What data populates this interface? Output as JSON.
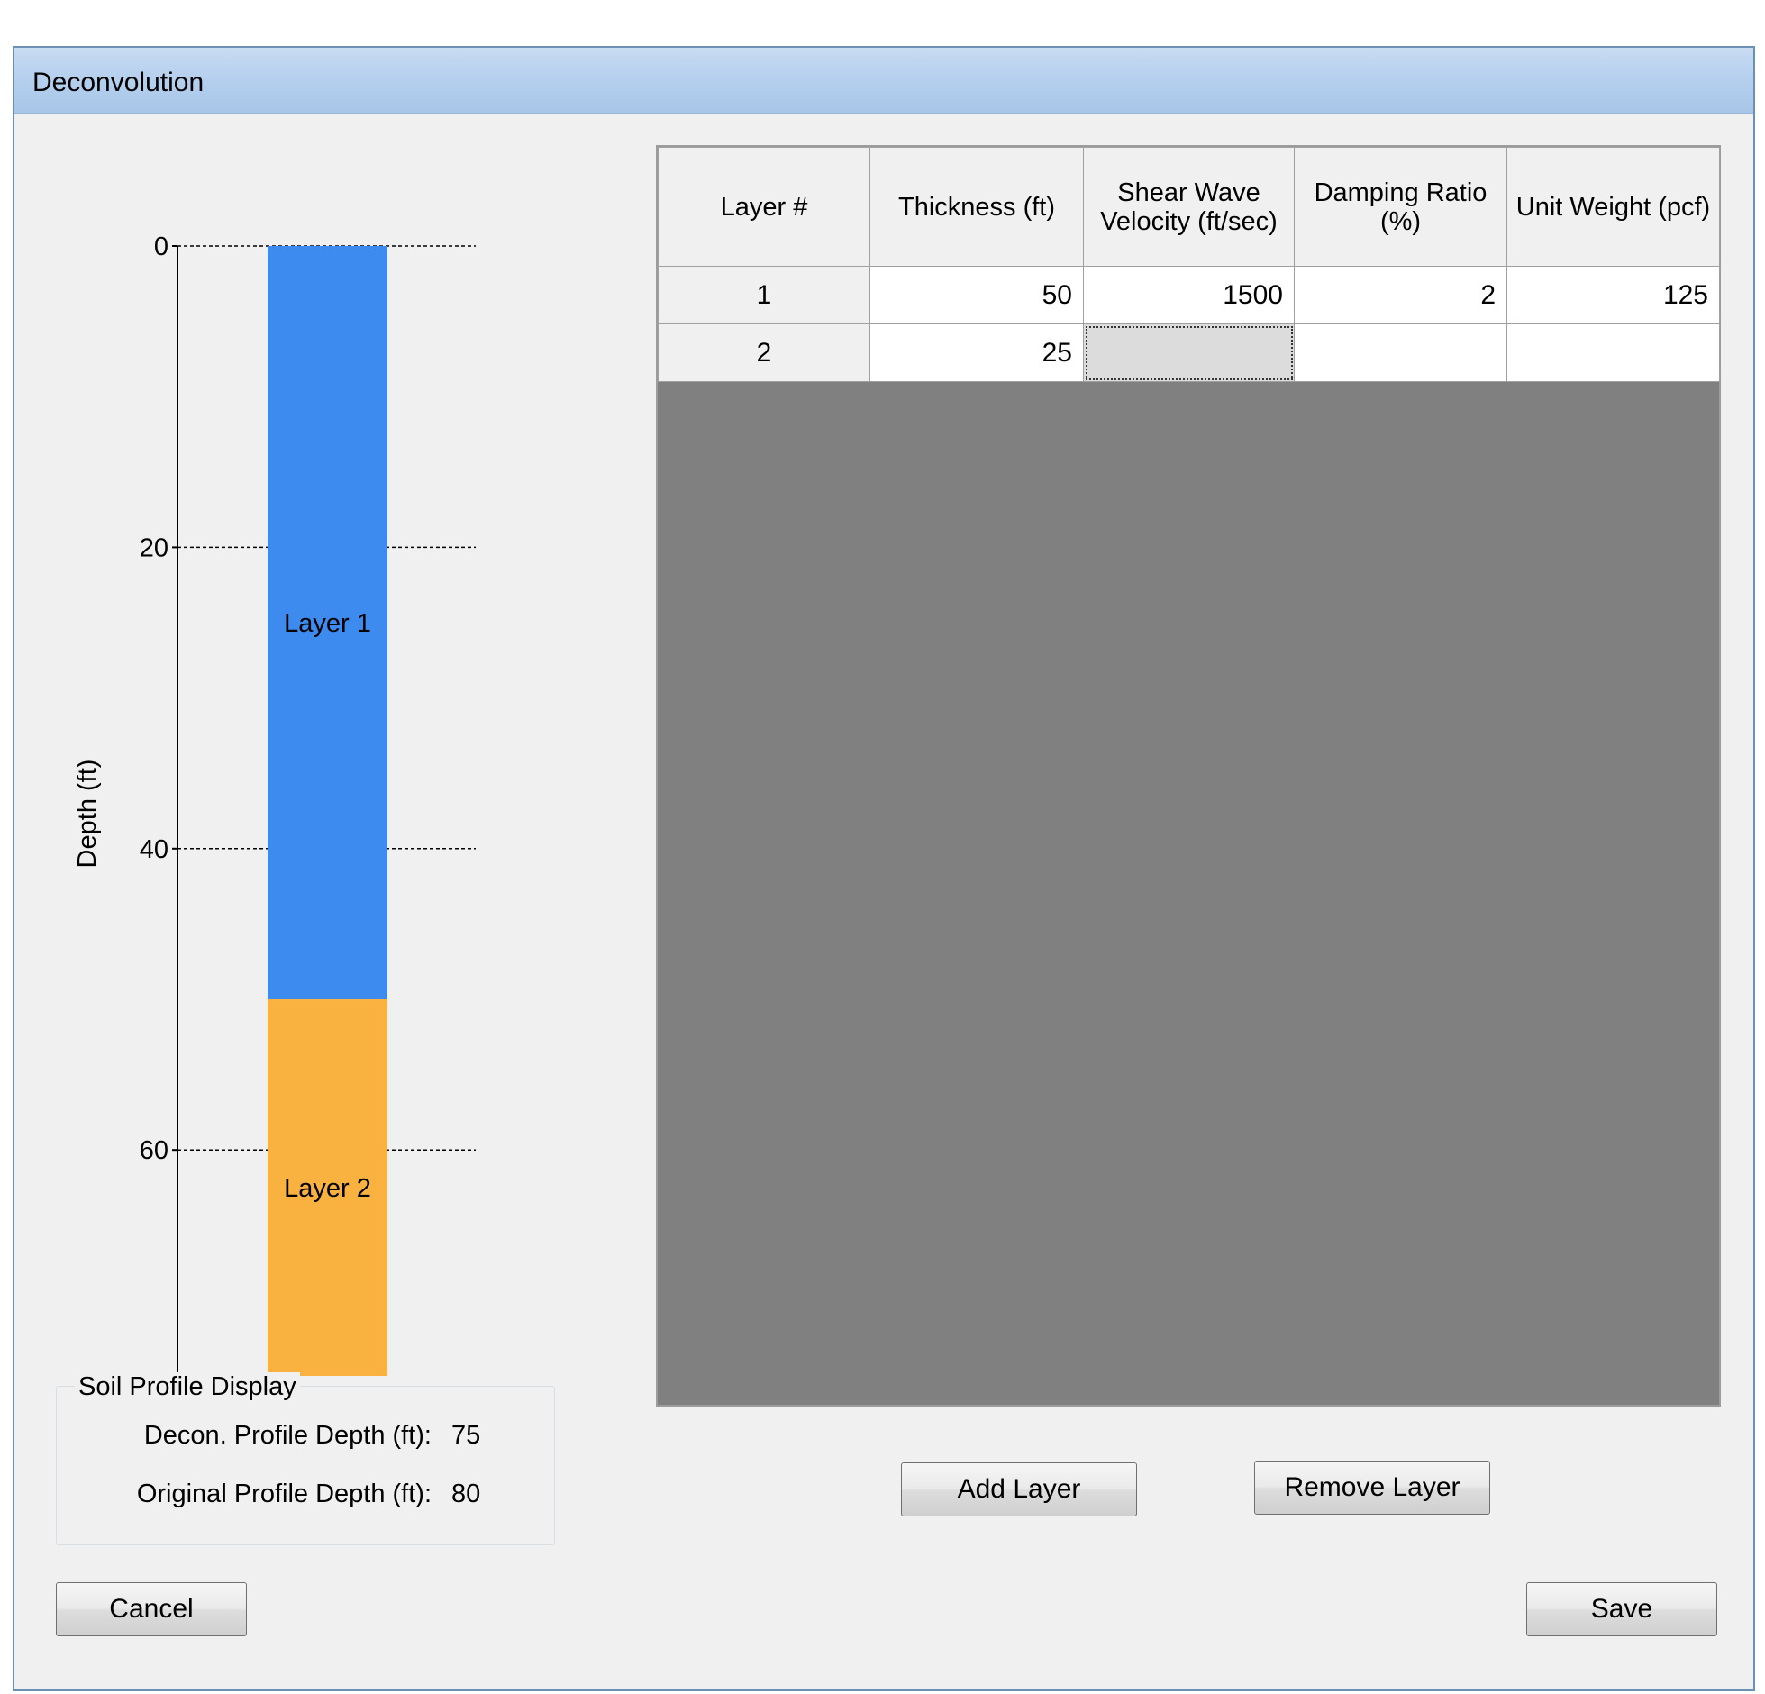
{
  "window": {
    "title": "Deconvolution"
  },
  "chart_data": {
    "type": "bar",
    "ylabel": "Depth (ft)",
    "ylim": [
      0,
      75
    ],
    "y_ticks": [
      0,
      20,
      40,
      60
    ],
    "y_inverted": true,
    "grid": "dashed horizontal at ticks",
    "layers": [
      {
        "label": "Layer 1",
        "top": 0,
        "bottom": 50,
        "color": "#3e8bf0"
      },
      {
        "label": "Layer 2",
        "top": 50,
        "bottom": 75,
        "color": "#f9b13f"
      }
    ]
  },
  "soil_profile": {
    "title": "Soil Profile Display",
    "decon_label": "Decon. Profile Depth (ft):",
    "decon_value": "75",
    "original_label": "Original Profile Depth (ft):",
    "original_value": "80"
  },
  "grid": {
    "columns": [
      "Layer #",
      "Thickness (ft)",
      "Shear Wave Velocity (ft/sec)",
      "Damping Ratio (%)",
      "Unit Weight (pcf)"
    ],
    "rows": [
      [
        "1",
        "50",
        "1500",
        "2",
        "125"
      ],
      [
        "2",
        "25",
        "",
        "",
        ""
      ]
    ]
  },
  "buttons": {
    "add_layer": "Add Layer",
    "remove_layer": "Remove Layer",
    "cancel": "Cancel",
    "save": "Save"
  }
}
